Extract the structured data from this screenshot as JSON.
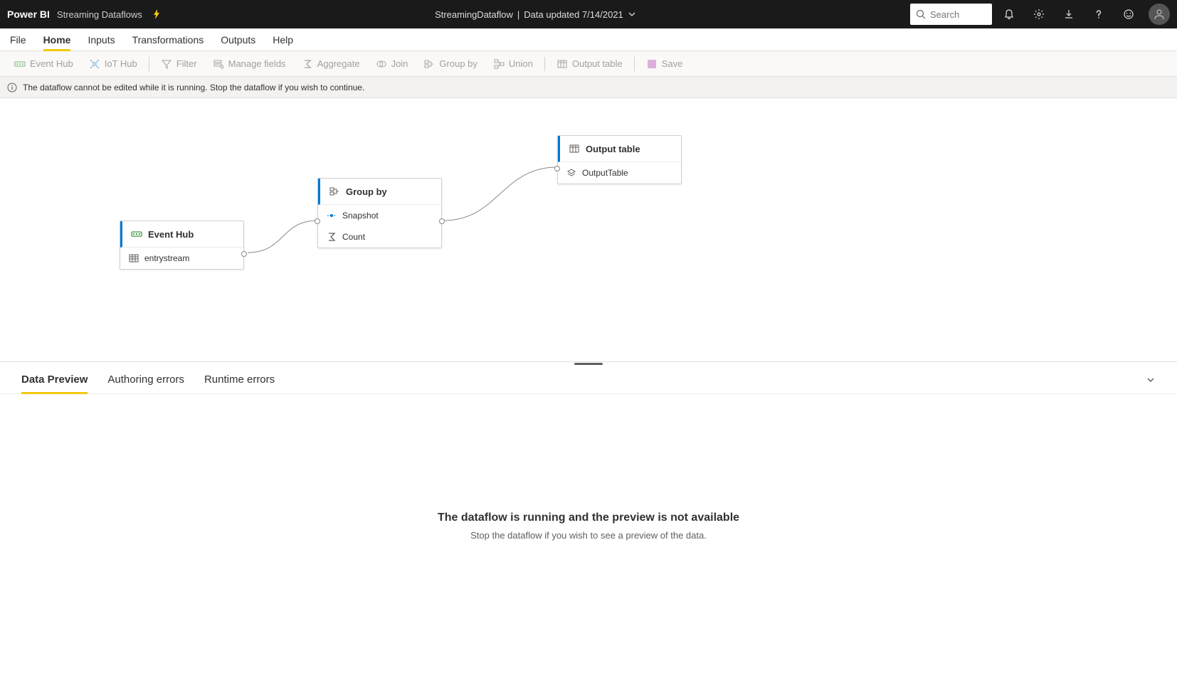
{
  "header": {
    "app": "Power BI",
    "subtitle": "Streaming Dataflows",
    "center_title": "StreamingDataflow",
    "center_status": "Data updated 7/14/2021",
    "search_placeholder": "Search"
  },
  "ribbon": {
    "tabs": [
      "File",
      "Home",
      "Inputs",
      "Transformations",
      "Outputs",
      "Help"
    ],
    "active": "Home"
  },
  "toolbar": {
    "event_hub": "Event Hub",
    "iot_hub": "IoT Hub",
    "filter": "Filter",
    "manage_fields": "Manage fields",
    "aggregate": "Aggregate",
    "join": "Join",
    "group_by": "Group by",
    "union": "Union",
    "output_table": "Output table",
    "save": "Save"
  },
  "infobar": {
    "message": "The dataflow cannot be edited while it is running. Stop the dataflow if you wish to continue."
  },
  "nodes": {
    "event_hub": {
      "title": "Event Hub",
      "row1": "entrystream"
    },
    "group_by": {
      "title": "Group by",
      "row1": "Snapshot",
      "row2": "Count"
    },
    "output_table": {
      "title": "Output table",
      "row1": "OutputTable"
    }
  },
  "bottom": {
    "tabs": [
      "Data Preview",
      "Authoring errors",
      "Runtime errors"
    ],
    "active": "Data Preview",
    "title": "The dataflow is running and the preview is not available",
    "subtitle": "Stop the dataflow if you wish to see a preview of the data."
  }
}
